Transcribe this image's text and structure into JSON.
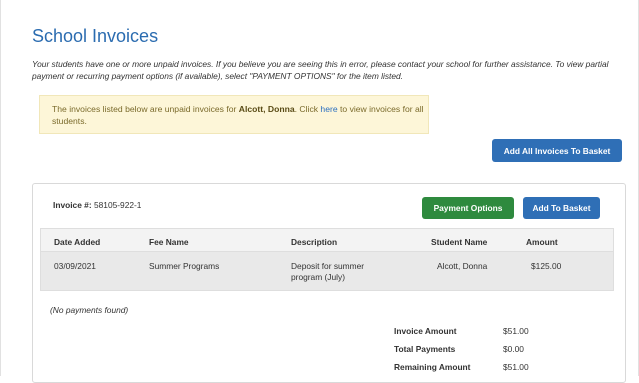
{
  "page": {
    "title": "School Invoices",
    "intro": "Your students have one or more unpaid invoices. If you believe you are seeing this in error, please contact your school for further assistance. To view partial payment or recurring payment options (if available), select \"PAYMENT OPTIONS\" for the item listed."
  },
  "alert": {
    "prefix": "The invoices listed below are unpaid invoices for ",
    "student": "Alcott, Donna",
    "middle": ". Click ",
    "link": "here",
    "suffix": " to view invoices for all students."
  },
  "actions": {
    "add_all": "Add All Invoices To Basket"
  },
  "invoice": {
    "number_label": "Invoice #:",
    "number": "58105-922-1",
    "payment_options": "Payment Options",
    "add_to_basket": "Add To Basket",
    "columns": [
      "Date Added",
      "Fee Name",
      "Description",
      "Student Name",
      "Amount"
    ],
    "rows": [
      {
        "date_added": "03/09/2021",
        "fee_name": "Summer Programs",
        "description": "Deposit for summer program (July)",
        "student_name": "Alcott, Donna",
        "amount": "$125.00"
      }
    ],
    "no_payments": "(No payments found)",
    "summary": [
      {
        "label": "Invoice Amount",
        "value": "$51.00"
      },
      {
        "label": "Total Payments",
        "value": "$0.00"
      },
      {
        "label": "Remaining Amount",
        "value": "$51.00"
      }
    ]
  }
}
